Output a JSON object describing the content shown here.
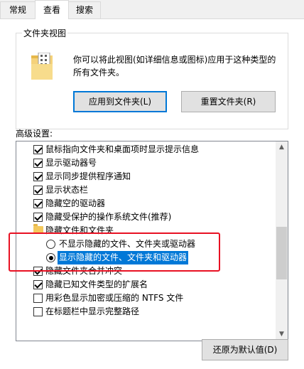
{
  "tabs": [
    "常规",
    "查看",
    "搜索"
  ],
  "folder_view": {
    "title": "文件夹视图",
    "description": "你可以将此视图(如详细信息或图标)应用于这种类型的所有文件夹。",
    "apply_button": "应用到文件夹(L)",
    "reset_button": "重置文件夹(R)"
  },
  "advanced": {
    "label": "高级设置:",
    "items": [
      {
        "type": "checkbox",
        "checked": true,
        "label": "鼠标指向文件夹和桌面项时显示提示信息"
      },
      {
        "type": "checkbox",
        "checked": true,
        "label": "显示驱动器号"
      },
      {
        "type": "checkbox",
        "checked": true,
        "label": "显示同步提供程序通知"
      },
      {
        "type": "checkbox",
        "checked": true,
        "label": "显示状态栏"
      },
      {
        "type": "checkbox",
        "checked": true,
        "label": "隐藏空的驱动器"
      },
      {
        "type": "checkbox",
        "checked": true,
        "label": "隐藏受保护的操作系统文件(推荐)"
      },
      {
        "type": "folder",
        "label": "隐藏文件和文件夹"
      },
      {
        "type": "radio",
        "selected": false,
        "label": "不显示隐藏的文件、文件夹或驱动器"
      },
      {
        "type": "radio",
        "selected": true,
        "label": "显示隐藏的文件、文件夹和驱动器"
      },
      {
        "type": "checkbox",
        "checked": true,
        "label": "隐藏文件夹合并冲突"
      },
      {
        "type": "checkbox",
        "checked": true,
        "label": "隐藏已知文件类型的扩展名"
      },
      {
        "type": "checkbox",
        "checked": false,
        "label": "用彩色显示加密或压缩的 NTFS 文件"
      },
      {
        "type": "checkbox",
        "checked": false,
        "label": "在标题栏中显示完整路径"
      }
    ]
  },
  "restore_button": "还原为默认值(D)",
  "colors": {
    "accent": "#0078d7",
    "highlight_border": "#e81123",
    "folder": "#f4c95d"
  }
}
